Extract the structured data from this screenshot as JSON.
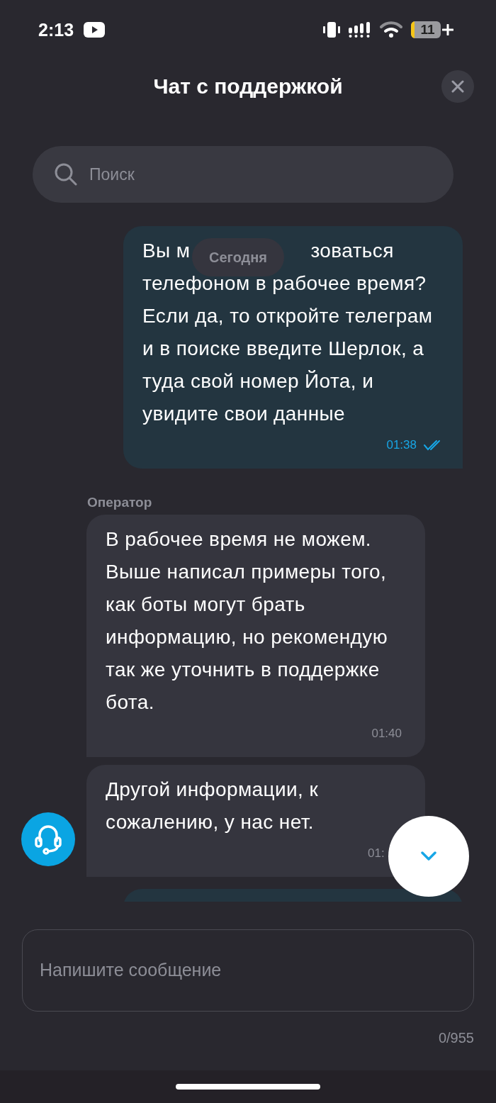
{
  "status_bar": {
    "time": "2:13",
    "battery": "11",
    "charging": true
  },
  "header": {
    "title": "Чат с поддержкой"
  },
  "search": {
    "placeholder": "Поиск"
  },
  "date_chip": "Сегодня",
  "messages": [
    {
      "kind": "outgoing",
      "first_line_left": "Вы м",
      "first_line_right": "зоваться",
      "text": "телефоном в рабочее время? Если да, то откройте телеграм и в поиске введите Шерлок, а туда свой номер Йота, и увидите свои данные",
      "time": "01:38",
      "read": true
    },
    {
      "kind": "incoming",
      "sender": "Оператор",
      "text": "В рабочее время не можем. Выше написал примеры того, как боты могут брать информацию, но рекомендую так же уточнить в поддержке бота.",
      "time": "01:40"
    },
    {
      "kind": "incoming",
      "text": "Другой информации, к сожалению, у нас нет.",
      "time": "01:",
      "avatar": true
    },
    {
      "kind": "outgoing_cut"
    }
  ],
  "composer": {
    "placeholder": "Напишите сообщение",
    "counter": "0/955"
  }
}
